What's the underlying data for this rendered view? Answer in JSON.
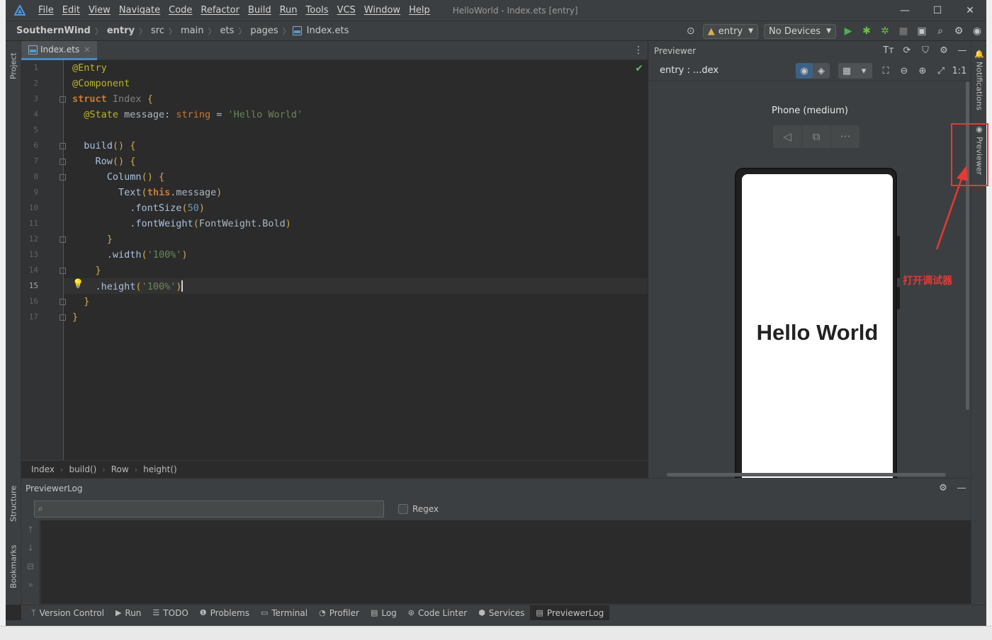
{
  "window": {
    "title": "HelloWorld - Index.ets [entry]",
    "minimize_icon": "minimize-icon",
    "maximize_icon": "maximize-icon",
    "close_icon": "close-icon"
  },
  "menu": [
    "File",
    "Edit",
    "View",
    "Navigate",
    "Code",
    "Refactor",
    "Build",
    "Run",
    "Tools",
    "VCS",
    "Window",
    "Help"
  ],
  "breadcrumb": [
    "SouthernWind",
    "entry",
    "src",
    "main",
    "ets",
    "pages",
    "Index.ets"
  ],
  "run_config": {
    "module": "entry",
    "device": "No Devices"
  },
  "left_tabs": {
    "project": "Project",
    "structure": "Structure",
    "bookmarks": "Bookmarks"
  },
  "right_tabs": {
    "notifications": "Notifications",
    "previewer": "Previewer"
  },
  "editor": {
    "tab_label": "Index.ets",
    "current_line": 15,
    "lines": [
      "@Entry",
      "@Component",
      "struct Index {",
      "  @State message: string = 'Hello World'",
      "",
      "  build() {",
      "    Row() {",
      "      Column() {",
      "        Text(this.message)",
      "          .fontSize(50)",
      "          .fontWeight(FontWeight.Bold)",
      "      }",
      "      .width('100%')",
      "    }",
      "    .height('100%')",
      "  }",
      "}"
    ],
    "footer_breadcrumb": [
      "Index",
      "build()",
      "Row",
      "height()"
    ]
  },
  "previewer": {
    "title": "Previewer",
    "target": "entry : ...dex",
    "device_name": "Phone (medium)",
    "preview_text": "Hello World"
  },
  "previewer_log": {
    "title": "PreviewerLog",
    "search_placeholder": "",
    "regex_label": "Regex"
  },
  "tool_tabs": [
    "Version Control",
    "Run",
    "TODO",
    "Problems",
    "Terminal",
    "Profiler",
    "Log",
    "Code Linter",
    "Services",
    "PreviewerLog"
  ],
  "annotation": {
    "text": "打开调试器",
    "color": "#e53935"
  },
  "colors": {
    "keyword": "#cc7832",
    "annotation": "#bbb529",
    "string": "#6a8759",
    "number": "#6897bb",
    "accent": "#4a88c7"
  }
}
